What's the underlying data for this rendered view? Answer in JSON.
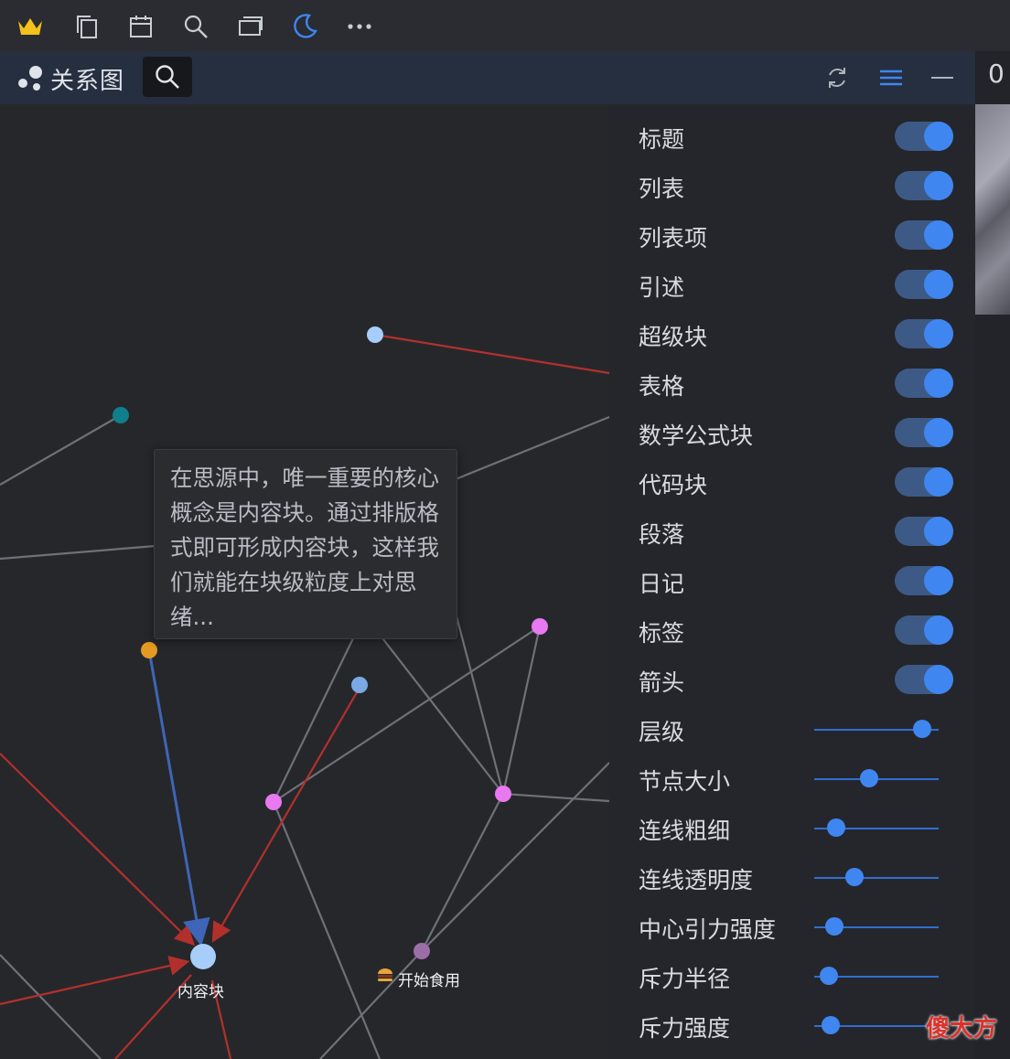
{
  "toolbar": {
    "icons": [
      "crown-icon",
      "copy-icon",
      "calendar-icon",
      "search-icon",
      "window-icon",
      "moon-icon",
      "more-icon"
    ]
  },
  "panel": {
    "title": "关系图",
    "strip_value": "0"
  },
  "tooltip": {
    "text": "在思源中，唯一重要的核心概念是内容块。通过排版格式即可形成内容块，这样我们就能在块级粒度上对思绪..."
  },
  "graph": {
    "labels": {
      "content_block": "内容块",
      "start_using": "开始食用"
    },
    "colors": {
      "gray_edge": "#6e7178",
      "red_edge": "#b2302c",
      "blue_edge": "#3f65b8",
      "node_light_blue": "#a7cdfa",
      "node_blue": "#7aa9e6",
      "node_teal": "#0f7f8e",
      "node_orange": "#e49a22",
      "node_pink": "#e879f0",
      "node_purple": "#9b6ea8"
    }
  },
  "settings": {
    "toggles": [
      {
        "label": "标题",
        "on": true
      },
      {
        "label": "列表",
        "on": true
      },
      {
        "label": "列表项",
        "on": true
      },
      {
        "label": "引述",
        "on": true
      },
      {
        "label": "超级块",
        "on": true
      },
      {
        "label": "表格",
        "on": true
      },
      {
        "label": "数学公式块",
        "on": true
      },
      {
        "label": "代码块",
        "on": true
      },
      {
        "label": "段落",
        "on": true
      },
      {
        "label": "日记",
        "on": true
      },
      {
        "label": "标签",
        "on": true
      },
      {
        "label": "箭头",
        "on": true
      }
    ],
    "sliders": [
      {
        "label": "层级",
        "value": 0.87
      },
      {
        "label": "节点大小",
        "value": 0.44
      },
      {
        "label": "连线粗细",
        "value": 0.18
      },
      {
        "label": "连线透明度",
        "value": 0.32
      },
      {
        "label": "中心引力强度",
        "value": 0.16
      },
      {
        "label": "斥力半径",
        "value": 0.12
      },
      {
        "label": "斥力强度",
        "value": 0.13
      }
    ]
  },
  "watermark": "傻大方",
  "accent_color": "#3f86f0"
}
